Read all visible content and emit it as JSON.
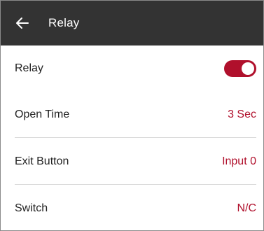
{
  "header": {
    "back_icon": "arrow-left-icon",
    "title": "Relay"
  },
  "settings": {
    "relay": {
      "label": "Relay",
      "enabled": true
    },
    "open_time": {
      "label": "Open Time",
      "value": "3 Sec"
    },
    "exit_button": {
      "label": "Exit Button",
      "value": "Input 0"
    },
    "switch": {
      "label": "Switch",
      "value": "N/C"
    }
  },
  "colors": {
    "header_bg": "#333333",
    "accent": "#b0102c",
    "divider": "#d9d9d9"
  }
}
